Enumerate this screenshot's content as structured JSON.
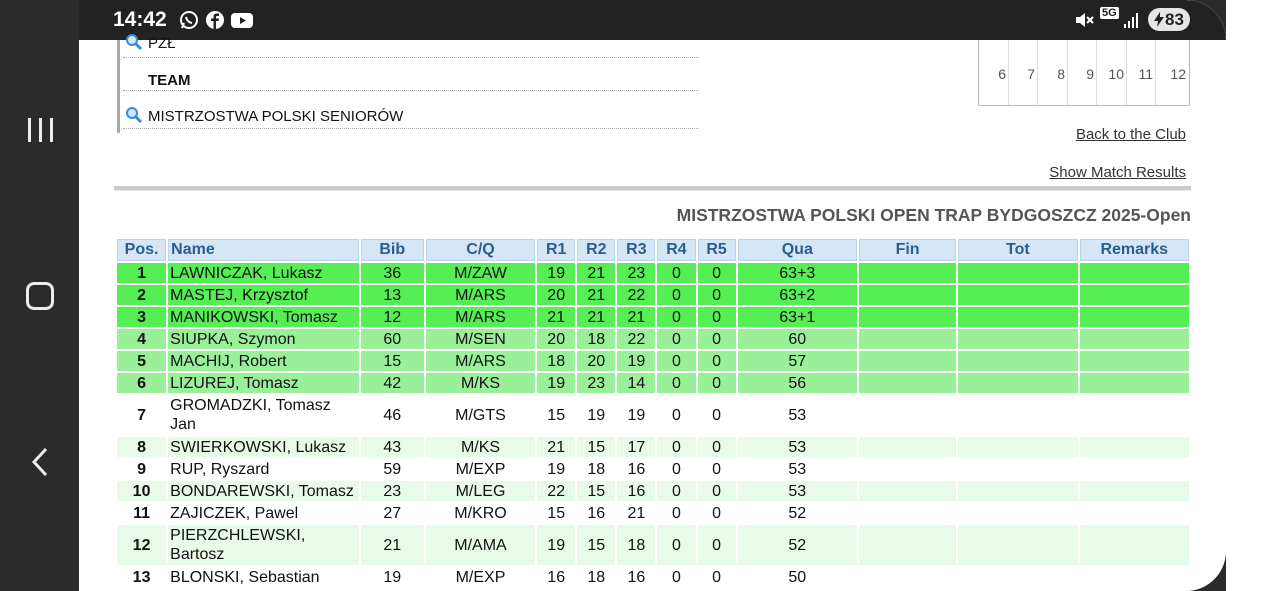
{
  "status_bar": {
    "time": "14:42",
    "left_icons": [
      "whatsapp-icon",
      "facebook-icon",
      "youtube-icon"
    ],
    "network_label": "5G",
    "battery": "83"
  },
  "info": {
    "rows": [
      {
        "text": "PZŁ",
        "icon": "search-icon"
      },
      {
        "text": "TEAM",
        "icon": ""
      },
      {
        "text": "MISTRZOSTWA POLSKI SENIORÓW",
        "icon": "search-icon"
      }
    ]
  },
  "mini_stats": {
    "numbers": [
      "6",
      "7",
      "8",
      "9",
      "10",
      "11",
      "12"
    ]
  },
  "links": {
    "back": "Back to the Club",
    "show_results": "Show Match Results"
  },
  "event_title": "MISTRZOSTWA POLSKI OPEN TRAP BYDGOSZCZ 2025-Open",
  "table": {
    "headers": [
      "Pos.",
      "Name",
      "Bib",
      "C/Q",
      "R1",
      "R2",
      "R3",
      "R4",
      "R5",
      "Qua",
      "Fin",
      "Tot",
      "Remarks"
    ],
    "rows": [
      {
        "pos": "1",
        "name": "LAWNICZAK, Lukasz",
        "bib": "36",
        "cq": "M/ZAW",
        "r1": "19",
        "r2": "21",
        "r3": "23",
        "r4": "0",
        "r5": "0",
        "qua": "63+3",
        "fin": "",
        "tot": "",
        "remarks": ""
      },
      {
        "pos": "2",
        "name": "MASTEJ, Krzysztof",
        "bib": "13",
        "cq": "M/ARS",
        "r1": "20",
        "r2": "21",
        "r3": "22",
        "r4": "0",
        "r5": "0",
        "qua": "63+2",
        "fin": "",
        "tot": "",
        "remarks": ""
      },
      {
        "pos": "3",
        "name": "MANIKOWSKI, Tomasz",
        "bib": "12",
        "cq": "M/ARS",
        "r1": "21",
        "r2": "21",
        "r3": "21",
        "r4": "0",
        "r5": "0",
        "qua": "63+1",
        "fin": "",
        "tot": "",
        "remarks": ""
      },
      {
        "pos": "4",
        "name": "SIUPKA, Szymon",
        "bib": "60",
        "cq": "M/SEN",
        "r1": "20",
        "r2": "18",
        "r3": "22",
        "r4": "0",
        "r5": "0",
        "qua": "60",
        "fin": "",
        "tot": "",
        "remarks": ""
      },
      {
        "pos": "5",
        "name": "MACHIJ, Robert",
        "bib": "15",
        "cq": "M/ARS",
        "r1": "18",
        "r2": "20",
        "r3": "19",
        "r4": "0",
        "r5": "0",
        "qua": "57",
        "fin": "",
        "tot": "",
        "remarks": ""
      },
      {
        "pos": "6",
        "name": "LIZUREJ, Tomasz",
        "bib": "42",
        "cq": "M/KS",
        "r1": "19",
        "r2": "23",
        "r3": "14",
        "r4": "0",
        "r5": "0",
        "qua": "56",
        "fin": "",
        "tot": "",
        "remarks": ""
      },
      {
        "pos": "7",
        "name": "GROMADZKI, Tomasz Jan",
        "bib": "46",
        "cq": "M/GTS",
        "r1": "15",
        "r2": "19",
        "r3": "19",
        "r4": "0",
        "r5": "0",
        "qua": "53",
        "fin": "",
        "tot": "",
        "remarks": ""
      },
      {
        "pos": "8",
        "name": "SWIERKOWSKI, Lukasz",
        "bib": "43",
        "cq": "M/KS",
        "r1": "21",
        "r2": "15",
        "r3": "17",
        "r4": "0",
        "r5": "0",
        "qua": "53",
        "fin": "",
        "tot": "",
        "remarks": ""
      },
      {
        "pos": "9",
        "name": "RUP, Ryszard",
        "bib": "59",
        "cq": "M/EXP",
        "r1": "19",
        "r2": "18",
        "r3": "16",
        "r4": "0",
        "r5": "0",
        "qua": "53",
        "fin": "",
        "tot": "",
        "remarks": ""
      },
      {
        "pos": "10",
        "name": "BONDAREWSKI, Tomasz",
        "bib": "23",
        "cq": "M/LEG",
        "r1": "22",
        "r2": "15",
        "r3": "16",
        "r4": "0",
        "r5": "0",
        "qua": "53",
        "fin": "",
        "tot": "",
        "remarks": ""
      },
      {
        "pos": "11",
        "name": "ZAJICZEK, Pawel",
        "bib": "27",
        "cq": "M/KRO",
        "r1": "15",
        "r2": "16",
        "r3": "21",
        "r4": "0",
        "r5": "0",
        "qua": "52",
        "fin": "",
        "tot": "",
        "remarks": ""
      },
      {
        "pos": "12",
        "name": "PIERZCHLEWSKI, Bartosz",
        "bib": "21",
        "cq": "M/AMA",
        "r1": "19",
        "r2": "15",
        "r3": "18",
        "r4": "0",
        "r5": "0",
        "qua": "52",
        "fin": "",
        "tot": "",
        "remarks": ""
      },
      {
        "pos": "13",
        "name": "BLONSKI, Sebastian",
        "bib": "19",
        "cq": "M/EXP",
        "r1": "16",
        "r2": "18",
        "r3": "16",
        "r4": "0",
        "r5": "0",
        "qua": "50",
        "fin": "",
        "tot": "",
        "remarks": ""
      }
    ]
  },
  "colors": {
    "top_rank": "#55ee55",
    "upper_rank": "#99f099",
    "stripe": "#e8fbe8",
    "header_bg": "#d5e6f7",
    "header_text": "#2a5e8e"
  }
}
